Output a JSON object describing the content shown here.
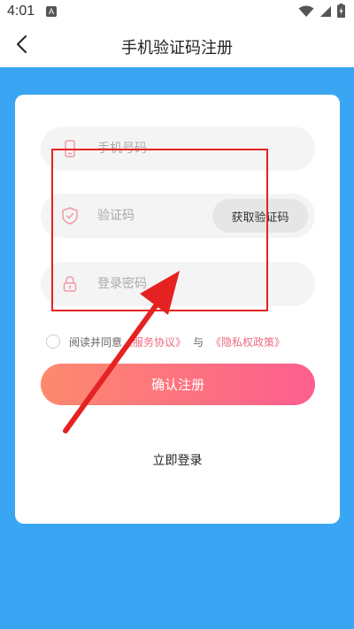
{
  "status_bar": {
    "time": "4:01",
    "app_icon_label": "A",
    "icons": [
      "wifi-icon",
      "signal-icon",
      "battery-icon"
    ]
  },
  "header": {
    "title": "手机验证码注册",
    "back_icon": "back-arrow-icon"
  },
  "form": {
    "phone": {
      "placeholder": "手机号码",
      "value": "",
      "icon": "phone-icon"
    },
    "code": {
      "placeholder": "验证码",
      "value": "",
      "icon": "shield-check-icon",
      "button_label": "获取验证码"
    },
    "password": {
      "placeholder": "登录密码",
      "value": "",
      "icon": "lock-icon"
    }
  },
  "agreement": {
    "prefix": "阅读并同意",
    "service_link": "《服务协议》",
    "and_text": "与",
    "privacy_link": "《隐私权政策》",
    "checked": false
  },
  "confirm_button_label": "确认注册",
  "login_link_label": "立即登录",
  "colors": {
    "background_blue": "#3aa6f3",
    "accent_pink": "#ef6a82",
    "gradient_start": "#fd8a6f",
    "gradient_end": "#fd5e8f",
    "annotation_red": "#e52222"
  }
}
